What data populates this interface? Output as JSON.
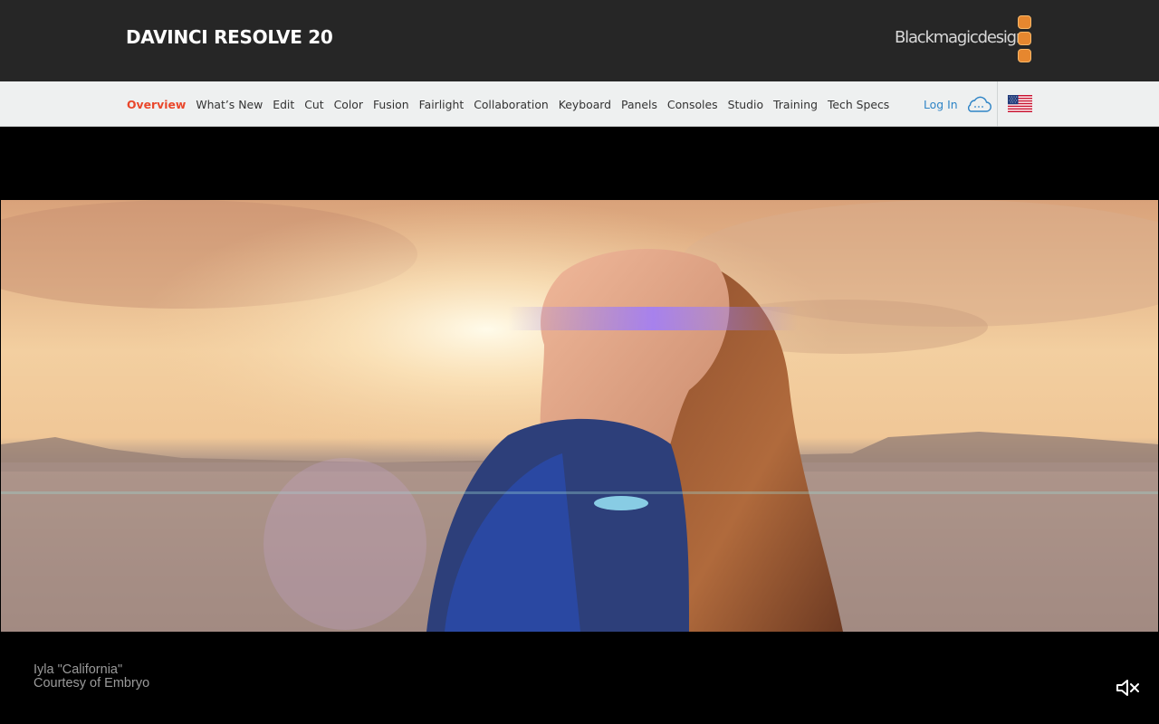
{
  "header": {
    "title": "DAVINCI RESOLVE 20",
    "brand_name": "Blackmagicdesign",
    "brand_color": "#e6872f"
  },
  "nav": {
    "items": [
      {
        "label": "Overview",
        "active": true
      },
      {
        "label": "What’s New"
      },
      {
        "label": "Edit"
      },
      {
        "label": "Cut"
      },
      {
        "label": "Color"
      },
      {
        "label": "Fusion"
      },
      {
        "label": "Fairlight"
      },
      {
        "label": "Collaboration"
      },
      {
        "label": "Keyboard"
      },
      {
        "label": "Panels"
      },
      {
        "label": "Consoles"
      },
      {
        "label": "Studio"
      },
      {
        "label": "Training"
      },
      {
        "label": "Tech Specs"
      }
    ],
    "login_label": "Log In",
    "login_icon": "cloud-icon",
    "region_icon": "us-flag-icon",
    "active_color": "#e9472b",
    "link_color": "#2e84c6"
  },
  "video": {
    "caption_line1": "Iyla \"California\"",
    "caption_line2": "Courtesy of Embryo",
    "mute_icon": "speaker-muted-icon"
  }
}
